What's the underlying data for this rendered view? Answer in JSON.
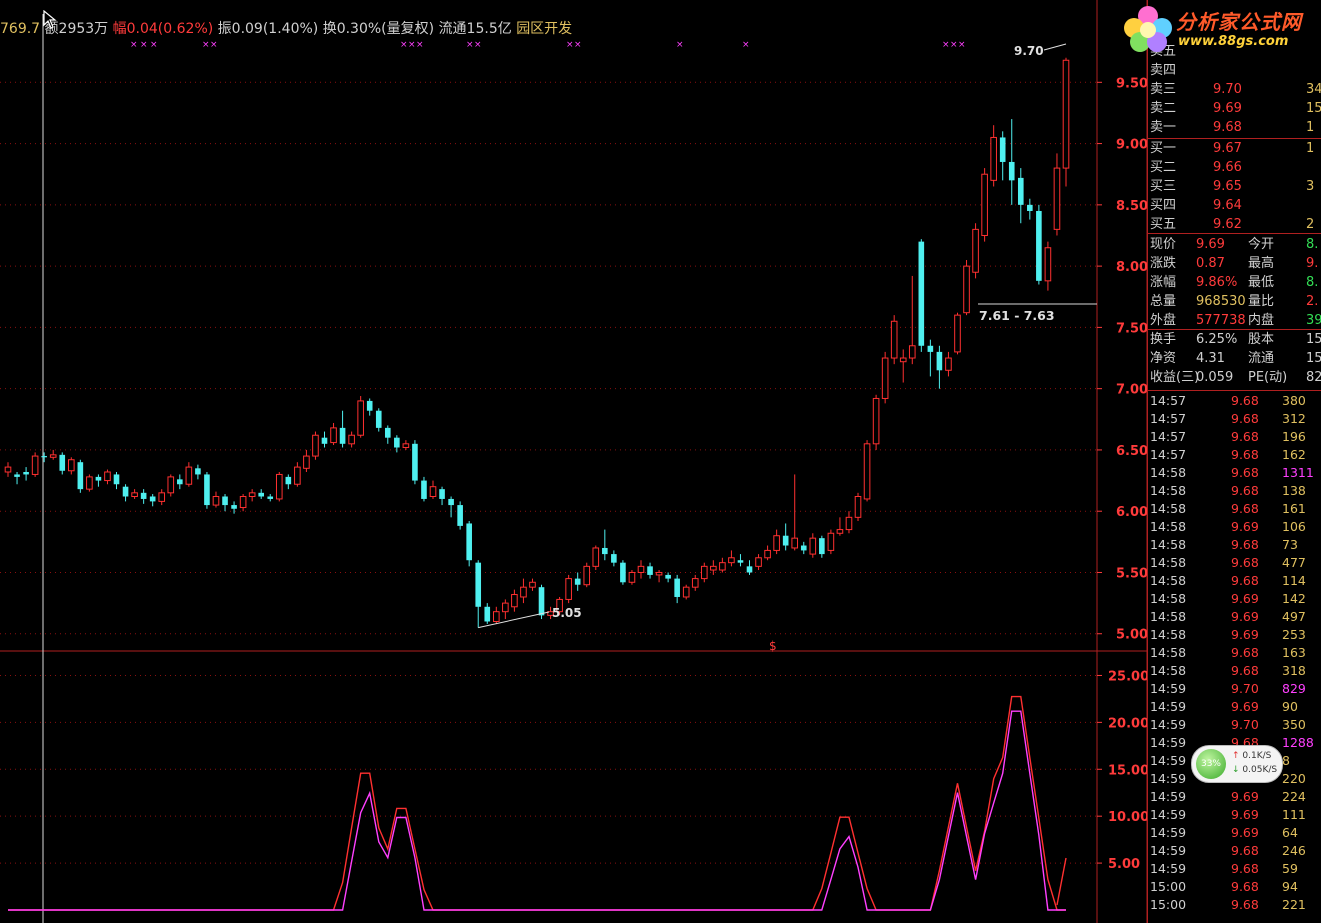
{
  "header": {
    "price": "769.7",
    "volume": "额2953万",
    "change_rate": "幅0.04(0.62%)",
    "amplitude": "振0.09(1.40%)",
    "turnover": "换0.30%(量复权)",
    "float": "流通15.5亿",
    "sector": "园区开发"
  },
  "logo": {
    "brand": "分析家公式网",
    "url": "www.88gs.com"
  },
  "chart_data": [
    {
      "type": "candlestick",
      "title": "",
      "ylim": [
        5.0,
        9.7
      ],
      "y_ticks": [
        "9.50",
        "9.00",
        "8.50",
        "8.00",
        "7.50",
        "7.00",
        "6.50",
        "6.00",
        "5.50",
        "5.00"
      ],
      "annotations": {
        "high": "9.70",
        "low": "5.05",
        "range": "7.61 - 7.63",
        "marker": "$"
      },
      "candles": [
        {
          "o": 6.32,
          "c": 6.36,
          "h": 6.4,
          "l": 6.28
        },
        {
          "o": 6.3,
          "c": 6.28,
          "h": 6.32,
          "l": 6.22
        },
        {
          "o": 6.32,
          "c": 6.3,
          "h": 6.36,
          "l": 6.25
        },
        {
          "o": 6.3,
          "c": 6.45,
          "h": 6.48,
          "l": 6.28
        },
        {
          "o": 6.45,
          "c": 6.44,
          "h": 6.48,
          "l": 6.4
        },
        {
          "o": 6.44,
          "c": 6.46,
          "h": 6.5,
          "l": 6.42
        },
        {
          "o": 6.46,
          "c": 6.33,
          "h": 6.48,
          "l": 6.3
        },
        {
          "o": 6.33,
          "c": 6.42,
          "h": 6.44,
          "l": 6.3
        },
        {
          "o": 6.4,
          "c": 6.18,
          "h": 6.42,
          "l": 6.15
        },
        {
          "o": 6.18,
          "c": 6.28,
          "h": 6.3,
          "l": 6.16
        },
        {
          "o": 6.28,
          "c": 6.25,
          "h": 6.3,
          "l": 6.2
        },
        {
          "o": 6.25,
          "c": 6.32,
          "h": 6.34,
          "l": 6.22
        },
        {
          "o": 6.3,
          "c": 6.22,
          "h": 6.32,
          "l": 6.18
        },
        {
          "o": 6.2,
          "c": 6.12,
          "h": 6.22,
          "l": 6.08
        },
        {
          "o": 6.12,
          "c": 6.15,
          "h": 6.18,
          "l": 6.1
        },
        {
          "o": 6.15,
          "c": 6.1,
          "h": 6.18,
          "l": 6.06
        },
        {
          "o": 6.12,
          "c": 6.08,
          "h": 6.14,
          "l": 6.04
        },
        {
          "o": 6.08,
          "c": 6.15,
          "h": 6.18,
          "l": 6.05
        },
        {
          "o": 6.15,
          "c": 6.28,
          "h": 6.3,
          "l": 6.12
        },
        {
          "o": 6.26,
          "c": 6.22,
          "h": 6.3,
          "l": 6.18
        },
        {
          "o": 6.22,
          "c": 6.36,
          "h": 6.4,
          "l": 6.2
        },
        {
          "o": 6.35,
          "c": 6.3,
          "h": 6.38,
          "l": 6.26
        },
        {
          "o": 6.3,
          "c": 6.05,
          "h": 6.32,
          "l": 6.02
        },
        {
          "o": 6.05,
          "c": 6.12,
          "h": 6.16,
          "l": 6.03
        },
        {
          "o": 6.12,
          "c": 6.05,
          "h": 6.14,
          "l": 6.0
        },
        {
          "o": 6.05,
          "c": 6.02,
          "h": 6.08,
          "l": 5.98
        },
        {
          "o": 6.03,
          "c": 6.12,
          "h": 6.14,
          "l": 6.0
        },
        {
          "o": 6.12,
          "c": 6.15,
          "h": 6.18,
          "l": 6.08
        },
        {
          "o": 6.15,
          "c": 6.12,
          "h": 6.18,
          "l": 6.1
        },
        {
          "o": 6.12,
          "c": 6.1,
          "h": 6.14,
          "l": 6.08
        },
        {
          "o": 6.1,
          "c": 6.3,
          "h": 6.32,
          "l": 6.08
        },
        {
          "o": 6.28,
          "c": 6.22,
          "h": 6.3,
          "l": 6.18
        },
        {
          "o": 6.22,
          "c": 6.36,
          "h": 6.4,
          "l": 6.2
        },
        {
          "o": 6.35,
          "c": 6.45,
          "h": 6.5,
          "l": 6.32
        },
        {
          "o": 6.45,
          "c": 6.62,
          "h": 6.65,
          "l": 6.42
        },
        {
          "o": 6.6,
          "c": 6.55,
          "h": 6.65,
          "l": 6.52
        },
        {
          "o": 6.56,
          "c": 6.68,
          "h": 6.72,
          "l": 6.54
        },
        {
          "o": 6.68,
          "c": 6.55,
          "h": 6.82,
          "l": 6.52
        },
        {
          "o": 6.55,
          "c": 6.62,
          "h": 6.65,
          "l": 6.52
        },
        {
          "o": 6.62,
          "c": 6.9,
          "h": 6.94,
          "l": 6.6
        },
        {
          "o": 6.9,
          "c": 6.82,
          "h": 6.92,
          "l": 6.78
        },
        {
          "o": 6.82,
          "c": 6.68,
          "h": 6.84,
          "l": 6.65
        },
        {
          "o": 6.68,
          "c": 6.6,
          "h": 6.7,
          "l": 6.55
        },
        {
          "o": 6.6,
          "c": 6.52,
          "h": 6.62,
          "l": 6.48
        },
        {
          "o": 6.52,
          "c": 6.55,
          "h": 6.58,
          "l": 6.5
        },
        {
          "o": 6.55,
          "c": 6.25,
          "h": 6.58,
          "l": 6.22
        },
        {
          "o": 6.25,
          "c": 6.1,
          "h": 6.28,
          "l": 6.08
        },
        {
          "o": 6.12,
          "c": 6.2,
          "h": 6.25,
          "l": 6.1
        },
        {
          "o": 6.18,
          "c": 6.1,
          "h": 6.2,
          "l": 6.05
        },
        {
          "o": 6.1,
          "c": 6.05,
          "h": 6.12,
          "l": 5.95
        },
        {
          "o": 6.05,
          "c": 5.88,
          "h": 6.08,
          "l": 5.85
        },
        {
          "o": 5.9,
          "c": 5.6,
          "h": 5.92,
          "l": 5.55
        },
        {
          "o": 5.58,
          "c": 5.22,
          "h": 5.6,
          "l": 5.05
        },
        {
          "o": 5.22,
          "c": 5.1,
          "h": 5.25,
          "l": 5.08
        },
        {
          "o": 5.1,
          "c": 5.18,
          "h": 5.22,
          "l": 5.08
        },
        {
          "o": 5.18,
          "c": 5.25,
          "h": 5.28,
          "l": 5.12
        },
        {
          "o": 5.22,
          "c": 5.32,
          "h": 5.36,
          "l": 5.18
        },
        {
          "o": 5.3,
          "c": 5.38,
          "h": 5.45,
          "l": 5.25
        },
        {
          "o": 5.38,
          "c": 5.42,
          "h": 5.45,
          "l": 5.35
        },
        {
          "o": 5.38,
          "c": 5.15,
          "h": 5.4,
          "l": 5.12
        },
        {
          "o": 5.15,
          "c": 5.18,
          "h": 5.22,
          "l": 5.12
        },
        {
          "o": 5.18,
          "c": 5.28,
          "h": 5.3,
          "l": 5.15
        },
        {
          "o": 5.28,
          "c": 5.45,
          "h": 5.48,
          "l": 5.25
        },
        {
          "o": 5.45,
          "c": 5.4,
          "h": 5.5,
          "l": 5.35
        },
        {
          "o": 5.4,
          "c": 5.55,
          "h": 5.58,
          "l": 5.38
        },
        {
          "o": 5.55,
          "c": 5.7,
          "h": 5.72,
          "l": 5.52
        },
        {
          "o": 5.7,
          "c": 5.65,
          "h": 5.85,
          "l": 5.6
        },
        {
          "o": 5.65,
          "c": 5.58,
          "h": 5.68,
          "l": 5.55
        },
        {
          "o": 5.58,
          "c": 5.42,
          "h": 5.6,
          "l": 5.4
        },
        {
          "o": 5.42,
          "c": 5.5,
          "h": 5.52,
          "l": 5.4
        },
        {
          "o": 5.5,
          "c": 5.55,
          "h": 5.6,
          "l": 5.45
        },
        {
          "o": 5.55,
          "c": 5.48,
          "h": 5.58,
          "l": 5.45
        },
        {
          "o": 5.48,
          "c": 5.5,
          "h": 5.52,
          "l": 5.42
        },
        {
          "o": 5.48,
          "c": 5.45,
          "h": 5.5,
          "l": 5.42
        },
        {
          "o": 5.45,
          "c": 5.3,
          "h": 5.48,
          "l": 5.25
        },
        {
          "o": 5.3,
          "c": 5.38,
          "h": 5.4,
          "l": 5.28
        },
        {
          "o": 5.38,
          "c": 5.45,
          "h": 5.48,
          "l": 5.35
        },
        {
          "o": 5.45,
          "c": 5.55,
          "h": 5.58,
          "l": 5.42
        },
        {
          "o": 5.52,
          "c": 5.55,
          "h": 5.6,
          "l": 5.48
        },
        {
          "o": 5.52,
          "c": 5.58,
          "h": 5.62,
          "l": 5.5
        },
        {
          "o": 5.58,
          "c": 5.62,
          "h": 5.68,
          "l": 5.55
        },
        {
          "o": 5.6,
          "c": 5.58,
          "h": 5.65,
          "l": 5.55
        },
        {
          "o": 5.55,
          "c": 5.5,
          "h": 5.6,
          "l": 5.48
        },
        {
          "o": 5.55,
          "c": 5.62,
          "h": 5.65,
          "l": 5.52
        },
        {
          "o": 5.62,
          "c": 5.68,
          "h": 5.72,
          "l": 5.6
        },
        {
          "o": 5.68,
          "c": 5.8,
          "h": 5.85,
          "l": 5.65
        },
        {
          "o": 5.8,
          "c": 5.72,
          "h": 5.9,
          "l": 5.68
        },
        {
          "o": 5.7,
          "c": 5.78,
          "h": 6.3,
          "l": 5.68
        },
        {
          "o": 5.72,
          "c": 5.68,
          "h": 5.75,
          "l": 5.65
        },
        {
          "o": 5.65,
          "c": 5.78,
          "h": 5.82,
          "l": 5.62
        },
        {
          "o": 5.78,
          "c": 5.65,
          "h": 5.8,
          "l": 5.62
        },
        {
          "o": 5.68,
          "c": 5.82,
          "h": 5.85,
          "l": 5.65
        },
        {
          "o": 5.82,
          "c": 5.85,
          "h": 5.95,
          "l": 5.8
        },
        {
          "o": 5.85,
          "c": 5.95,
          "h": 6.0,
          "l": 5.82
        },
        {
          "o": 5.95,
          "c": 6.12,
          "h": 6.15,
          "l": 5.92
        },
        {
          "o": 6.1,
          "c": 6.55,
          "h": 6.58,
          "l": 6.08
        },
        {
          "o": 6.55,
          "c": 6.92,
          "h": 6.95,
          "l": 6.5
        },
        {
          "o": 6.92,
          "c": 7.25,
          "h": 7.3,
          "l": 6.88
        },
        {
          "o": 7.25,
          "c": 7.55,
          "h": 7.6,
          "l": 7.2
        },
        {
          "o": 7.22,
          "c": 7.25,
          "h": 7.32,
          "l": 7.05
        },
        {
          "o": 7.25,
          "c": 7.35,
          "h": 7.92,
          "l": 7.2
        },
        {
          "o": 8.2,
          "c": 7.35,
          "h": 8.22,
          "l": 7.3
        },
        {
          "o": 7.35,
          "c": 7.3,
          "h": 7.4,
          "l": 7.1
        },
        {
          "o": 7.3,
          "c": 7.15,
          "h": 7.35,
          "l": 7.0
        },
        {
          "o": 7.15,
          "c": 7.25,
          "h": 7.3,
          "l": 7.1
        },
        {
          "o": 7.3,
          "c": 7.6,
          "h": 7.62,
          "l": 7.28
        },
        {
          "o": 7.62,
          "c": 8.0,
          "h": 8.05,
          "l": 7.6
        },
        {
          "o": 7.95,
          "c": 8.3,
          "h": 8.35,
          "l": 7.9
        },
        {
          "o": 8.25,
          "c": 8.75,
          "h": 8.8,
          "l": 8.2
        },
        {
          "o": 8.7,
          "c": 9.05,
          "h": 9.15,
          "l": 8.65
        },
        {
          "o": 9.05,
          "c": 8.85,
          "h": 9.1,
          "l": 8.7
        },
        {
          "o": 8.85,
          "c": 8.7,
          "h": 9.2,
          "l": 8.5
        },
        {
          "o": 8.72,
          "c": 8.5,
          "h": 8.8,
          "l": 8.35
        },
        {
          "o": 8.5,
          "c": 8.45,
          "h": 8.55,
          "l": 8.38
        },
        {
          "o": 8.45,
          "c": 7.88,
          "h": 8.5,
          "l": 7.85
        },
        {
          "o": 7.88,
          "c": 8.15,
          "h": 8.2,
          "l": 7.8
        },
        {
          "o": 8.3,
          "c": 8.8,
          "h": 8.92,
          "l": 8.25
        },
        {
          "o": 8.8,
          "c": 9.68,
          "h": 9.7,
          "l": 8.65
        }
      ]
    },
    {
      "type": "line",
      "title": "",
      "ylim": [
        0,
        25
      ],
      "y_ticks": [
        "25.00",
        "20.00",
        "15.00",
        "10.00",
        "5.00"
      ],
      "series": [
        {
          "color": "#ff3030",
          "values": [
            0,
            0,
            0,
            0,
            0,
            0,
            0,
            0,
            0,
            0,
            0,
            0,
            0,
            0,
            0,
            0,
            0,
            0,
            0,
            0,
            0,
            0,
            0,
            0,
            0,
            0,
            0,
            0,
            0,
            0,
            0,
            0,
            0,
            0,
            0,
            0,
            0,
            0,
            0,
            0,
            0,
            0,
            0,
            0,
            0,
            0,
            0,
            0,
            0,
            0,
            0,
            0,
            0,
            0,
            0,
            0,
            0,
            0,
            0,
            0,
            0,
            0,
            0,
            0,
            0,
            0,
            0,
            0,
            0,
            0,
            0,
            0,
            0,
            0,
            0,
            0,
            0,
            0,
            0,
            0,
            0,
            0,
            0,
            0,
            0,
            0,
            0,
            0,
            0,
            0,
            0,
            0,
            0,
            0,
            0,
            0,
            0,
            0,
            0,
            0,
            0,
            0,
            0,
            0,
            0,
            0,
            0,
            0,
            0,
            0,
            0,
            0,
            0,
            0,
            0,
            0,
            0,
            0,
            0,
            0,
            0,
            0
          ]
        },
        {
          "color": "#ff40ff",
          "values": [
            0,
            0
          ]
        }
      ]
    }
  ],
  "quote_panel": {
    "asks": [
      {
        "label": "卖五",
        "price": "",
        "vol": ""
      },
      {
        "label": "卖四",
        "price": "",
        "vol": ""
      },
      {
        "label": "卖三",
        "price": "9.70",
        "vol": "34"
      },
      {
        "label": "卖二",
        "price": "9.69",
        "vol": "15"
      },
      {
        "label": "卖一",
        "price": "9.68",
        "vol": "1"
      }
    ],
    "bids": [
      {
        "label": "买一",
        "price": "9.67",
        "vol": "1"
      },
      {
        "label": "买二",
        "price": "9.66",
        "vol": ""
      },
      {
        "label": "买三",
        "price": "9.65",
        "vol": "3"
      },
      {
        "label": "买四",
        "price": "9.64",
        "vol": ""
      },
      {
        "label": "买五",
        "price": "9.62",
        "vol": "2"
      }
    ],
    "stats": [
      {
        "l1": "现价",
        "v1": "9.69",
        "l2": "今开",
        "v2": "8."
      },
      {
        "l1": "涨跌",
        "v1": "0.87",
        "l2": "最高",
        "v2": "9."
      },
      {
        "l1": "涨幅",
        "v1": "9.86%",
        "l2": "最低",
        "v2": "8."
      },
      {
        "l1": "总量",
        "v1": "968530",
        "l2": "量比",
        "v2": "2."
      },
      {
        "l1": "外盘",
        "v1": "577738",
        "l2": "内盘",
        "v2": "3907"
      },
      {
        "l1": "换手",
        "v1": "6.25%",
        "l2": "股本",
        "v2": "15.5"
      },
      {
        "l1": "净资",
        "v1": "4.31",
        "l2": "流通",
        "v2": "15.5"
      },
      {
        "l1": "收益(三)",
        "v1": "0.059",
        "l2": "PE(动)",
        "v2": "82"
      }
    ],
    "ticks": [
      {
        "t": "14:57",
        "p": "9.68",
        "v": "380"
      },
      {
        "t": "14:57",
        "p": "9.68",
        "v": "312"
      },
      {
        "t": "14:57",
        "p": "9.68",
        "v": "196"
      },
      {
        "t": "14:57",
        "p": "9.68",
        "v": "162"
      },
      {
        "t": "14:58",
        "p": "9.68",
        "v": "1311"
      },
      {
        "t": "14:58",
        "p": "9.68",
        "v": "138"
      },
      {
        "t": "14:58",
        "p": "9.68",
        "v": "161"
      },
      {
        "t": "14:58",
        "p": "9.69",
        "v": "106"
      },
      {
        "t": "14:58",
        "p": "9.68",
        "v": "73"
      },
      {
        "t": "14:58",
        "p": "9.68",
        "v": "477"
      },
      {
        "t": "14:58",
        "p": "9.68",
        "v": "114"
      },
      {
        "t": "14:58",
        "p": "9.69",
        "v": "142"
      },
      {
        "t": "14:58",
        "p": "9.69",
        "v": "497"
      },
      {
        "t": "14:58",
        "p": "9.69",
        "v": "253"
      },
      {
        "t": "14:58",
        "p": "9.68",
        "v": "163"
      },
      {
        "t": "14:58",
        "p": "9.68",
        "v": "318"
      },
      {
        "t": "14:59",
        "p": "9.70",
        "v": "829"
      },
      {
        "t": "14:59",
        "p": "9.69",
        "v": "90"
      },
      {
        "t": "14:59",
        "p": "9.70",
        "v": "350"
      },
      {
        "t": "14:59",
        "p": "9.68",
        "v": "1288"
      },
      {
        "t": "14:59",
        "p": "9.69",
        "v": "8"
      },
      {
        "t": "14:59",
        "p": "9.68",
        "v": "220"
      },
      {
        "t": "14:59",
        "p": "9.69",
        "v": "224"
      },
      {
        "t": "14:59",
        "p": "9.69",
        "v": "111"
      },
      {
        "t": "14:59",
        "p": "9.69",
        "v": "64"
      },
      {
        "t": "14:59",
        "p": "9.68",
        "v": "246"
      },
      {
        "t": "14:59",
        "p": "9.68",
        "v": "59"
      },
      {
        "t": "15:00",
        "p": "9.68",
        "v": "94"
      },
      {
        "t": "15:00",
        "p": "9.68",
        "v": "221"
      }
    ]
  },
  "speed_widget": {
    "percent": "33%",
    "up": "0.1K/S",
    "down": "0.05K/S"
  },
  "colors": {
    "up": "#ff3030",
    "down": "#4ff0f0",
    "grid": "#8a1010",
    "axis": "#ff3b3b",
    "bg": "#000000"
  }
}
